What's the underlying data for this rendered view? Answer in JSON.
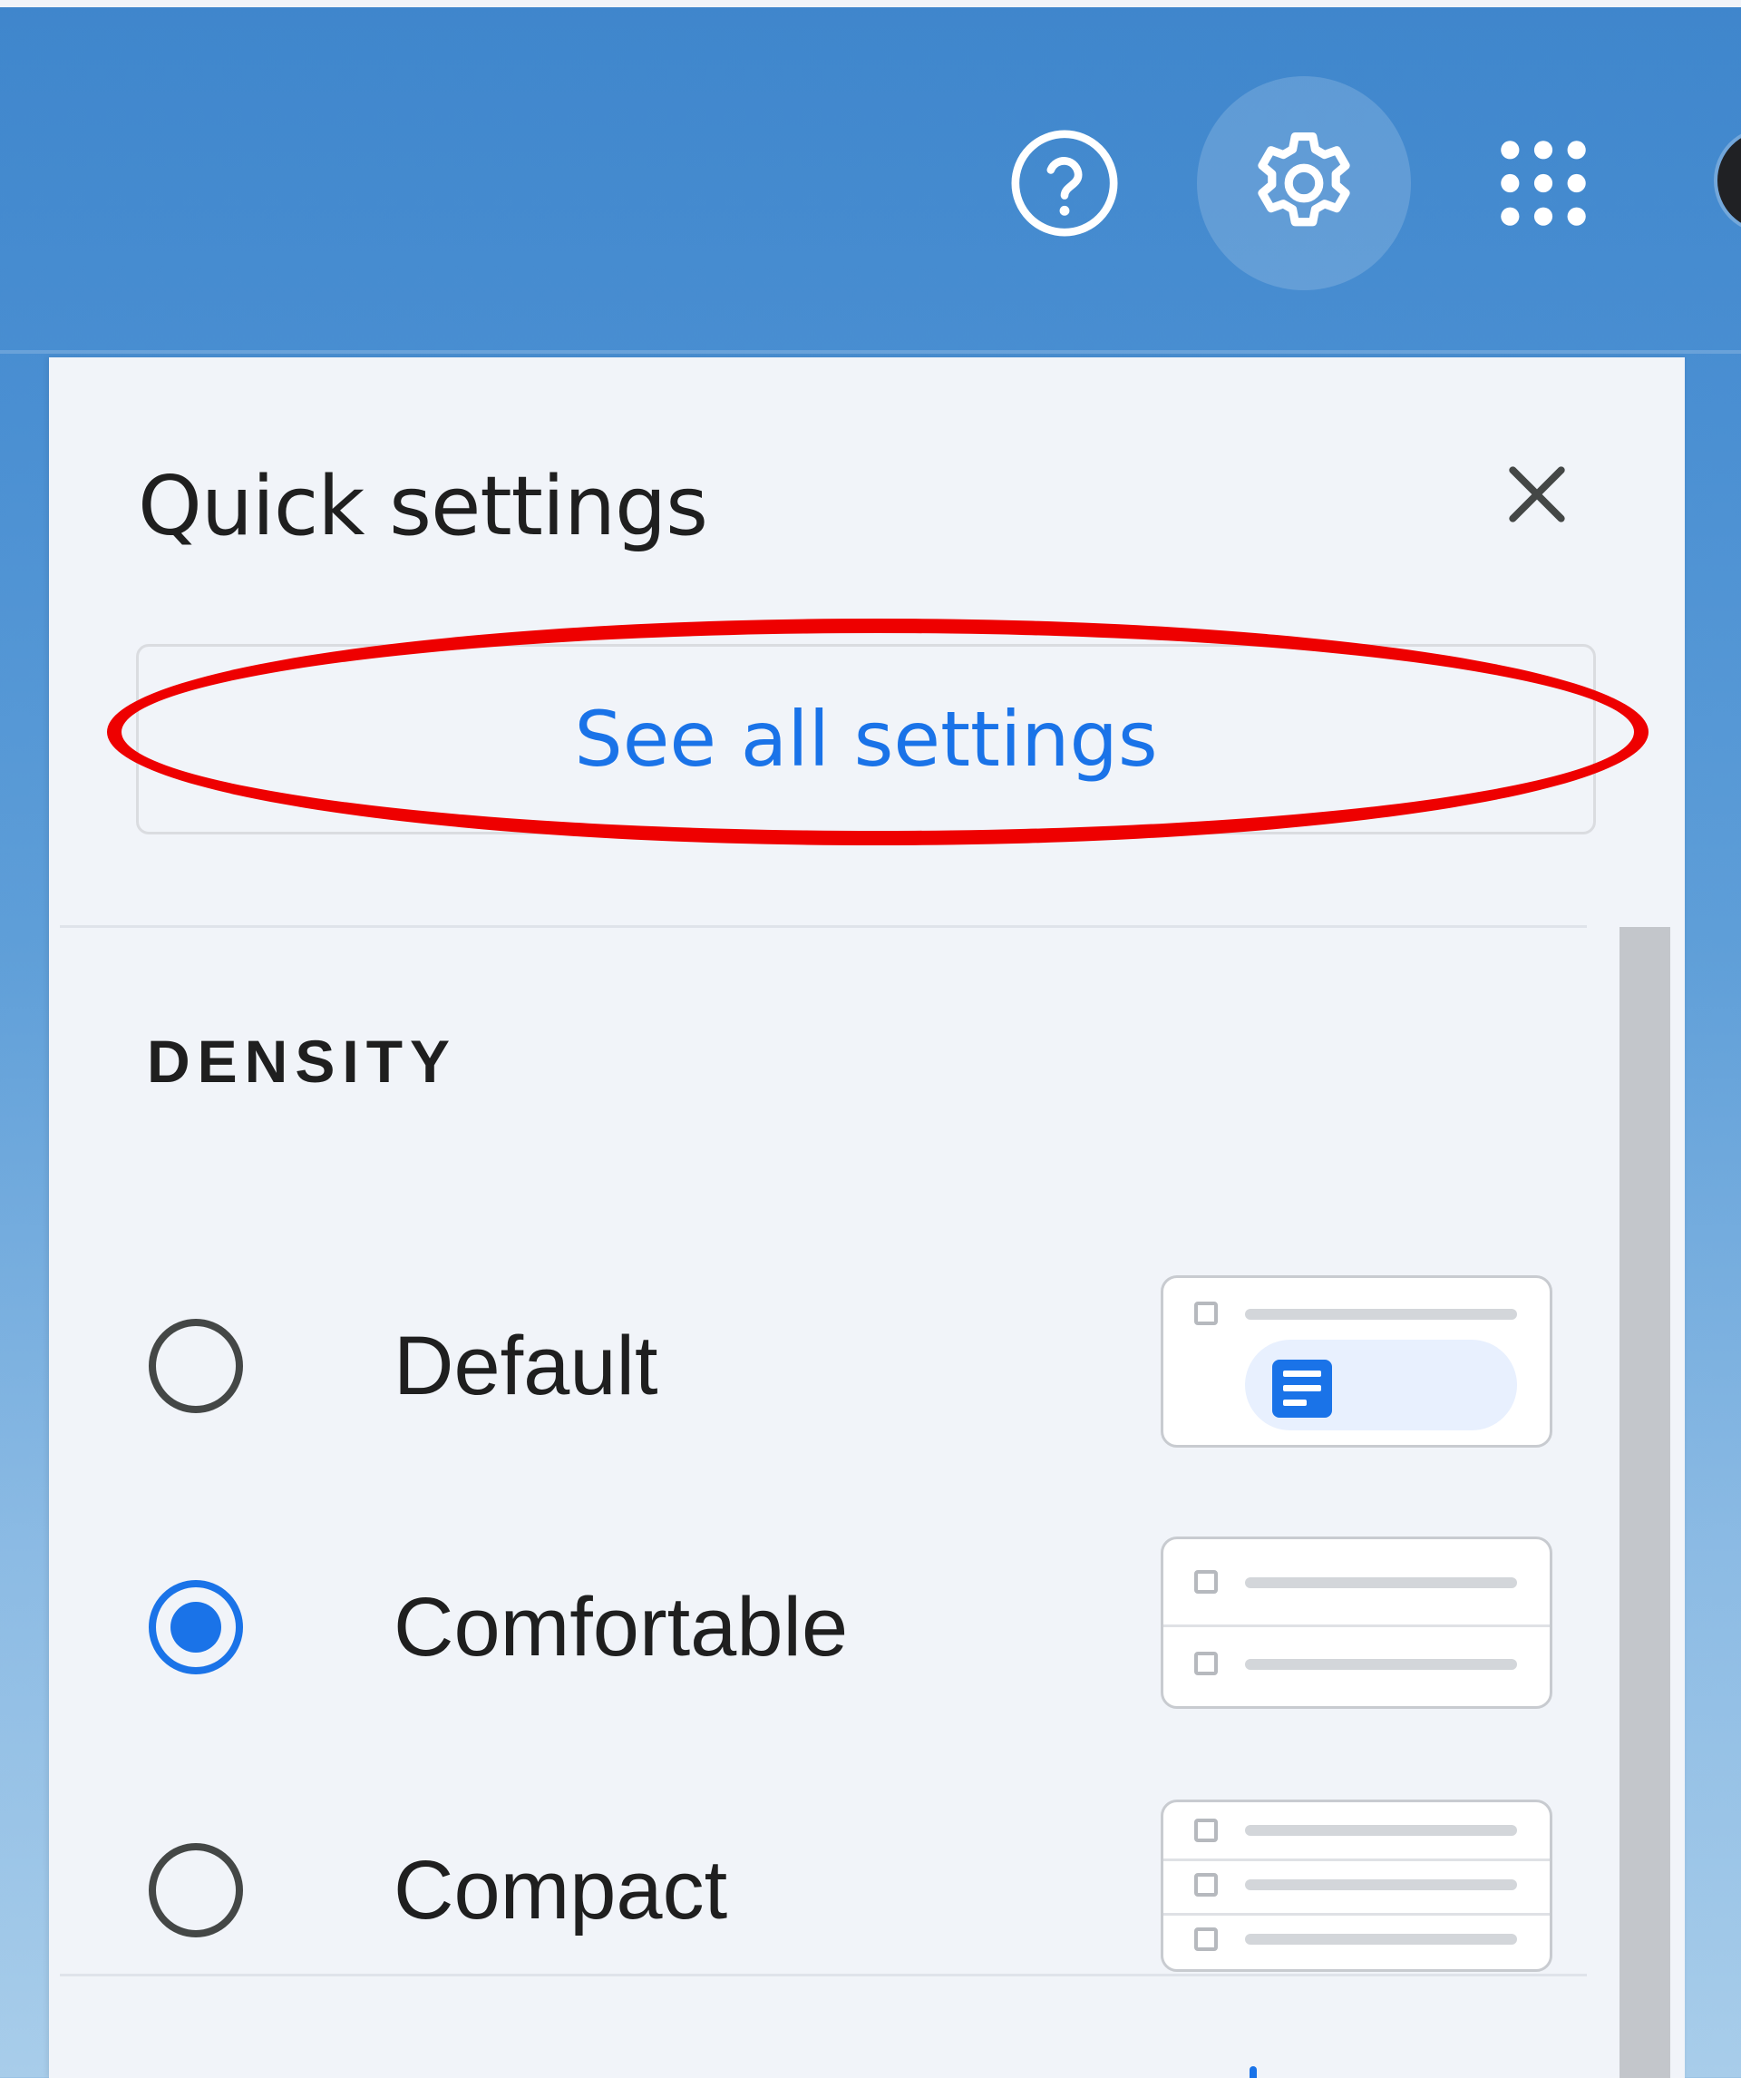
{
  "header": {
    "icons": [
      {
        "name": "help-icon",
        "glyph": "?"
      },
      {
        "name": "settings-icon",
        "glyph": "gear"
      },
      {
        "name": "apps-icon",
        "glyph": "grid"
      }
    ]
  },
  "panel": {
    "title": "Quick settings",
    "close_icon": "close-icon",
    "see_all_label": "See all settings",
    "density": {
      "heading": "DENSITY",
      "options": [
        {
          "label": "Default",
          "selected": false
        },
        {
          "label": "Comfortable",
          "selected": true
        },
        {
          "label": "Compact",
          "selected": false
        }
      ]
    }
  },
  "colors": {
    "accent": "#1a73e8",
    "panel_bg": "#f1f4f9",
    "annotation": "#ee0000",
    "text": "#1f1f1f"
  }
}
